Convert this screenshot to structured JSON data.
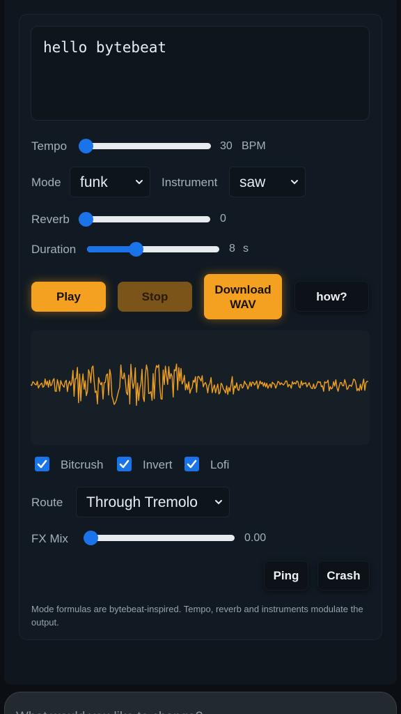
{
  "editor": {
    "code": "hello bytebeat"
  },
  "tempo": {
    "label": "Tempo",
    "value": "30",
    "unit": "BPM",
    "level": 0.0
  },
  "mode": {
    "label": "Mode",
    "selected": "funk"
  },
  "instrument": {
    "label": "Instrument",
    "selected": "saw"
  },
  "reverb": {
    "label": "Reverb",
    "value": "0",
    "level": 0.0
  },
  "duration": {
    "label": "Duration",
    "value": "8",
    "unit": "s",
    "level": 0.35
  },
  "buttons": {
    "play": "Play",
    "stop": "Stop",
    "download": "Download WAV",
    "how": "how?",
    "ping": "Ping",
    "crash": "Crash"
  },
  "checkboxes": [
    {
      "label": "Bitcrush",
      "checked": true
    },
    {
      "label": "Invert",
      "checked": true
    },
    {
      "label": "Lofi",
      "checked": true
    }
  ],
  "route": {
    "label": "Route",
    "selected": "Through Tremolo"
  },
  "fxmix": {
    "label": "FX Mix",
    "value": "0.00",
    "level": 0.0
  },
  "note": "Mode formulas are bytebeat-inspired. Tempo, reverb and instruments modulate the output.",
  "prompt": {
    "placeholder": "What would you like to change?"
  },
  "colors": {
    "accent": "#1a73e8",
    "button_orange": "#f4a020",
    "waveform": "#f0a020"
  },
  "icons": {
    "select": "chevron-down-icon",
    "checkbox": "check-icon"
  }
}
